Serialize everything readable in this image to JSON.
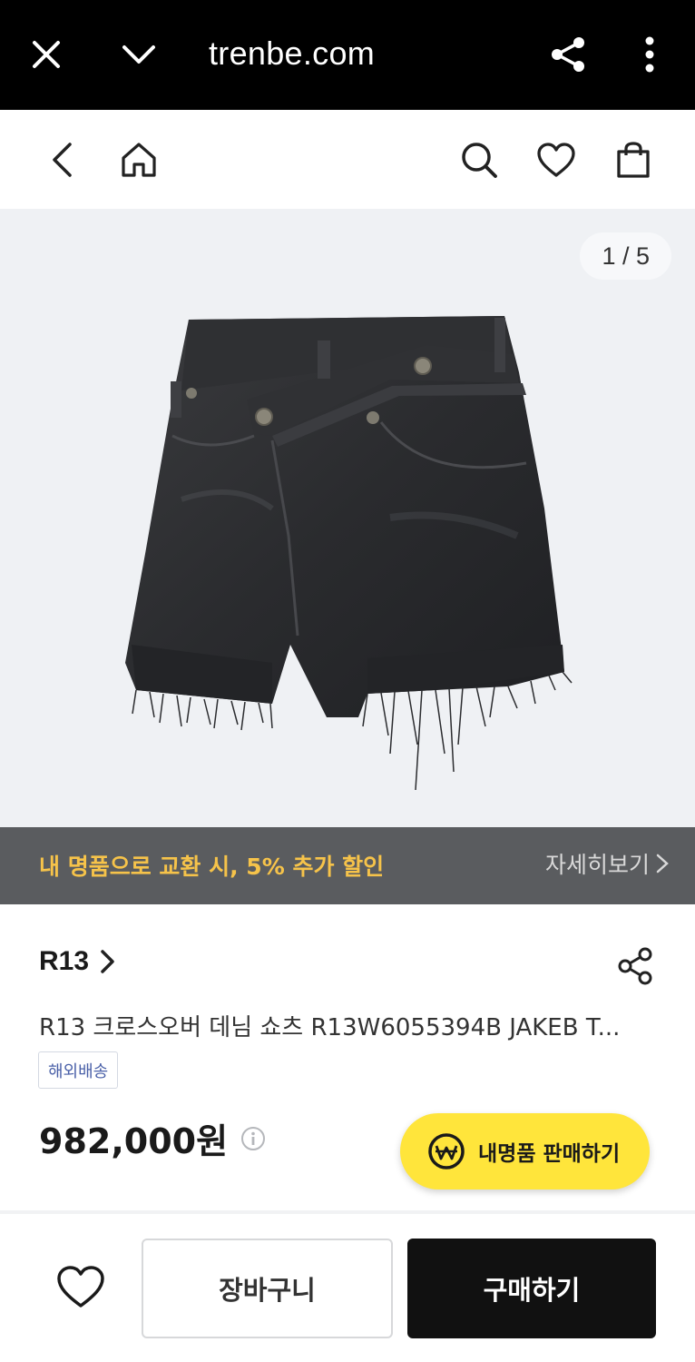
{
  "browser": {
    "url": "trenbe.com",
    "icons": [
      "close-icon",
      "chevron-down-icon",
      "share-icon",
      "more-vertical-icon"
    ]
  },
  "nav": {
    "icons": [
      "back-icon",
      "home-icon",
      "search-icon",
      "heart-icon",
      "shopping-bag-icon"
    ]
  },
  "gallery": {
    "counter": "1 / 5",
    "background": "#eff1f4"
  },
  "promo": {
    "text": "내 명품으로 교환 시, 5% 추가 할인",
    "more_label": "자세히보기",
    "background": "#5a5c5f",
    "text_color": "#f6c34a"
  },
  "product": {
    "brand": "R13",
    "title": "R13 크로스오버 데님 쇼츠 R13W6055394B JAKEB T...",
    "badge": "해외배송",
    "price": "982,000원"
  },
  "sell_button": {
    "label": "내명품 판매하기",
    "color": "#ffe53b"
  },
  "bottom_bar": {
    "cart_label": "장바구니",
    "buy_label": "구매하기"
  }
}
